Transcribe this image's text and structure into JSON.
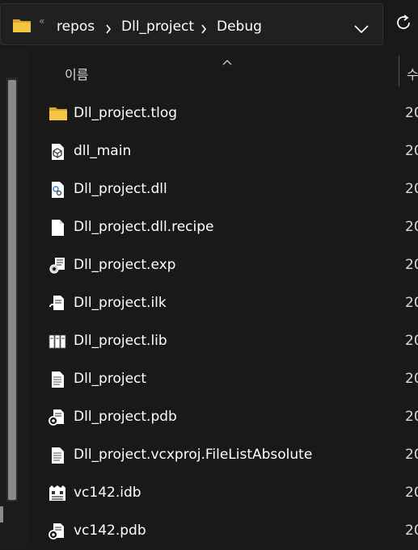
{
  "address_bar": {
    "crumbs": [
      "repos",
      "Dll_project",
      "Debug"
    ],
    "overflow_glyph": "«"
  },
  "columns": {
    "name": "이름",
    "date": "수"
  },
  "files": [
    {
      "name": "Dll_project.tlog",
      "icon": "folder-icon",
      "date": "20"
    },
    {
      "name": "dll_main",
      "icon": "cube-file-icon",
      "date": "20"
    },
    {
      "name": "Dll_project.dll",
      "icon": "dll-file-icon",
      "date": "20"
    },
    {
      "name": "Dll_project.dll.recipe",
      "icon": "blank-file-icon",
      "date": "20"
    },
    {
      "name": "Dll_project.exp",
      "icon": "exp-file-icon",
      "date": "20"
    },
    {
      "name": "Dll_project.ilk",
      "icon": "ilk-file-icon",
      "date": "20"
    },
    {
      "name": "Dll_project.lib",
      "icon": "lib-file-icon",
      "date": "20"
    },
    {
      "name": "Dll_project",
      "icon": "text-file-icon",
      "date": "20"
    },
    {
      "name": "Dll_project.pdb",
      "icon": "pdb-file-icon",
      "date": "20"
    },
    {
      "name": "Dll_project.vcxproj.FileListAbsolute",
      "icon": "text-file-icon",
      "date": "20"
    },
    {
      "name": "vc142.idb",
      "icon": "idb-file-icon",
      "date": "20"
    },
    {
      "name": "vc142.pdb",
      "icon": "pdb-file-icon",
      "date": "20"
    }
  ],
  "colors": {
    "background": "#191919",
    "folder": "#f4c542",
    "text": "#ffffff"
  }
}
